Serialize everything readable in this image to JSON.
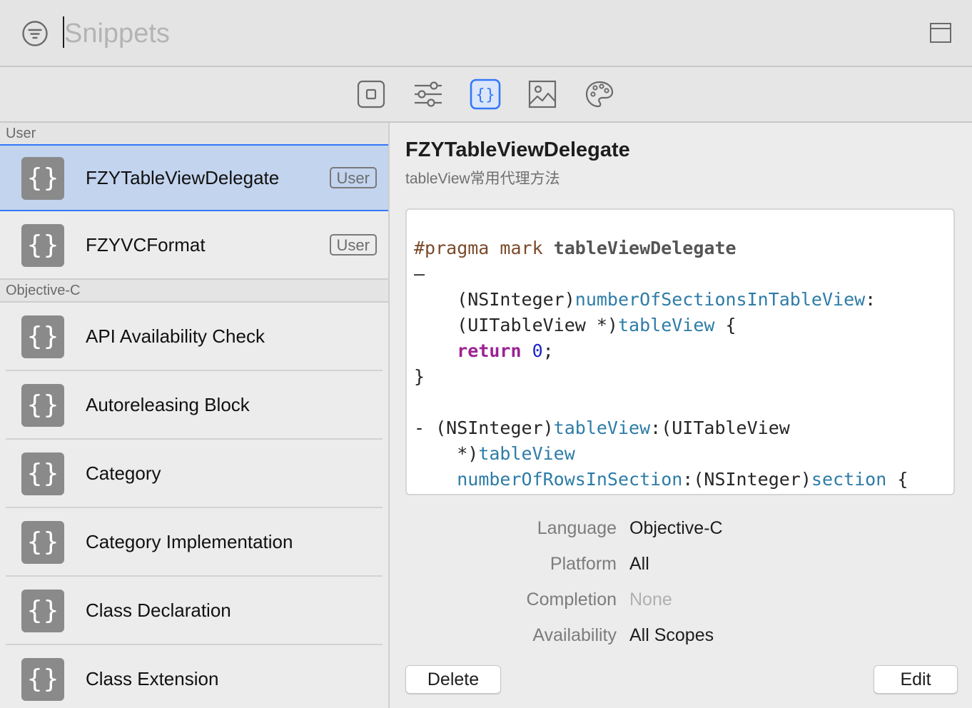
{
  "search": {
    "placeholder": "Snippets"
  },
  "toolbar": {
    "tabs": [
      {
        "icon": "views-icon",
        "active": false
      },
      {
        "icon": "modifiers-icon",
        "active": false
      },
      {
        "icon": "snippets-icon",
        "active": true
      },
      {
        "icon": "media-icon",
        "active": false
      },
      {
        "icon": "colors-icon",
        "active": false
      }
    ]
  },
  "sidebar": {
    "sections": [
      {
        "header": "User",
        "items": [
          {
            "label": "FZYTableViewDelegate",
            "badge": "User",
            "selected": true
          },
          {
            "label": "FZYVCFormat",
            "badge": "User",
            "selected": false
          }
        ]
      },
      {
        "header": "Objective-C",
        "items": [
          {
            "label": "API Availability Check"
          },
          {
            "label": "Autoreleasing Block"
          },
          {
            "label": "Category"
          },
          {
            "label": "Category Implementation"
          },
          {
            "label": "Class Declaration"
          },
          {
            "label": "Class Extension"
          }
        ]
      }
    ]
  },
  "detail": {
    "title": "FZYTableViewDelegate",
    "subtitle": "tableView常用代理方法",
    "code": {
      "l1a": "#pragma",
      "l1b": " mark ",
      "l1c": "tableViewDelegate",
      "l2": "–",
      "l3a": "    (NSInteger)",
      "l3b": "numberOfSectionsInTableView",
      "l3c": ":",
      "l4a": "    (UITableView *)",
      "l4b": "tableView",
      "l4c": " {",
      "l5a": "    ",
      "l5b": "return",
      "l5c": " ",
      "l5d": "0",
      "l5e": ";",
      "l6": "}",
      "l7": "",
      "l8a": "- (NSInteger)",
      "l8b": "tableView",
      "l8c": ":(UITableView",
      "l9a": "    *)",
      "l9b": "tableView",
      "l10a": "    ",
      "l10b": "numberOfRowsInSection",
      "l10c": ":(NSInteger)",
      "l10d": "section",
      "l10e": " {"
    },
    "properties": [
      {
        "key": "Language",
        "value": "Objective-C",
        "muted": false
      },
      {
        "key": "Platform",
        "value": "All",
        "muted": false
      },
      {
        "key": "Completion",
        "value": "None",
        "muted": true
      },
      {
        "key": "Availability",
        "value": "All Scopes",
        "muted": false
      }
    ],
    "delete_label": "Delete",
    "edit_label": "Edit"
  },
  "colors": {
    "accent": "#3478f6",
    "selection": "#c3d4ee",
    "snippet_icon_bg": "#8a8a8a"
  }
}
